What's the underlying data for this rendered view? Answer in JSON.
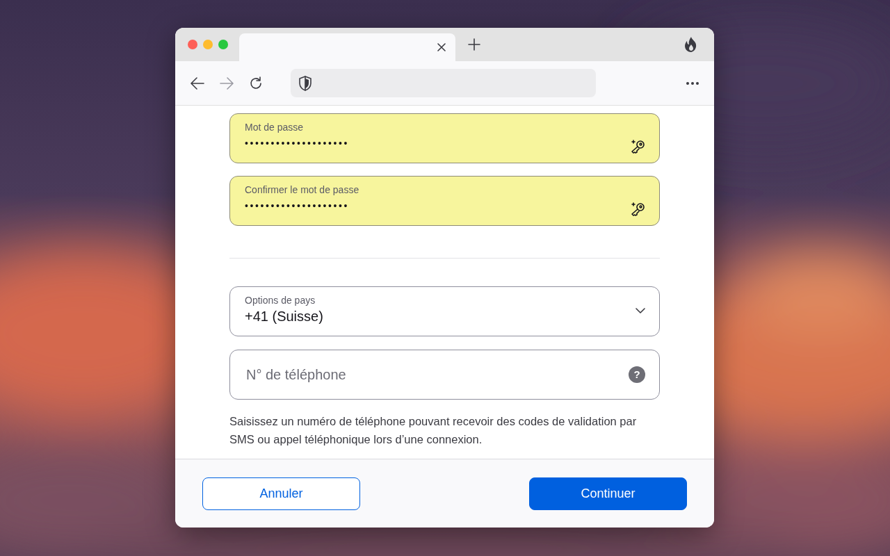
{
  "browser": {
    "tab": {
      "selected": true
    },
    "forward_disabled": true
  },
  "password_fields": [
    {
      "label": "Mot de passe",
      "value": "••••••••••••••••••••",
      "autofilled": true
    },
    {
      "label": "Confirmer le mot de passe",
      "value": "••••••••••••••••••••",
      "autofilled": true
    }
  ],
  "country_select": {
    "label": "Options de pays",
    "value": "+41 (Suisse)"
  },
  "phone_field": {
    "placeholder": "N° de téléphone",
    "help": "?"
  },
  "hint": "Saisissez un numéro de téléphone pouvant recevoir des codes de validation par SMS ou appel téléphonique lors d’une connexion.",
  "buttons": [
    {
      "label": "Annuler",
      "kind": "secondary"
    },
    {
      "label": "Continuer",
      "kind": "primary"
    }
  ]
}
